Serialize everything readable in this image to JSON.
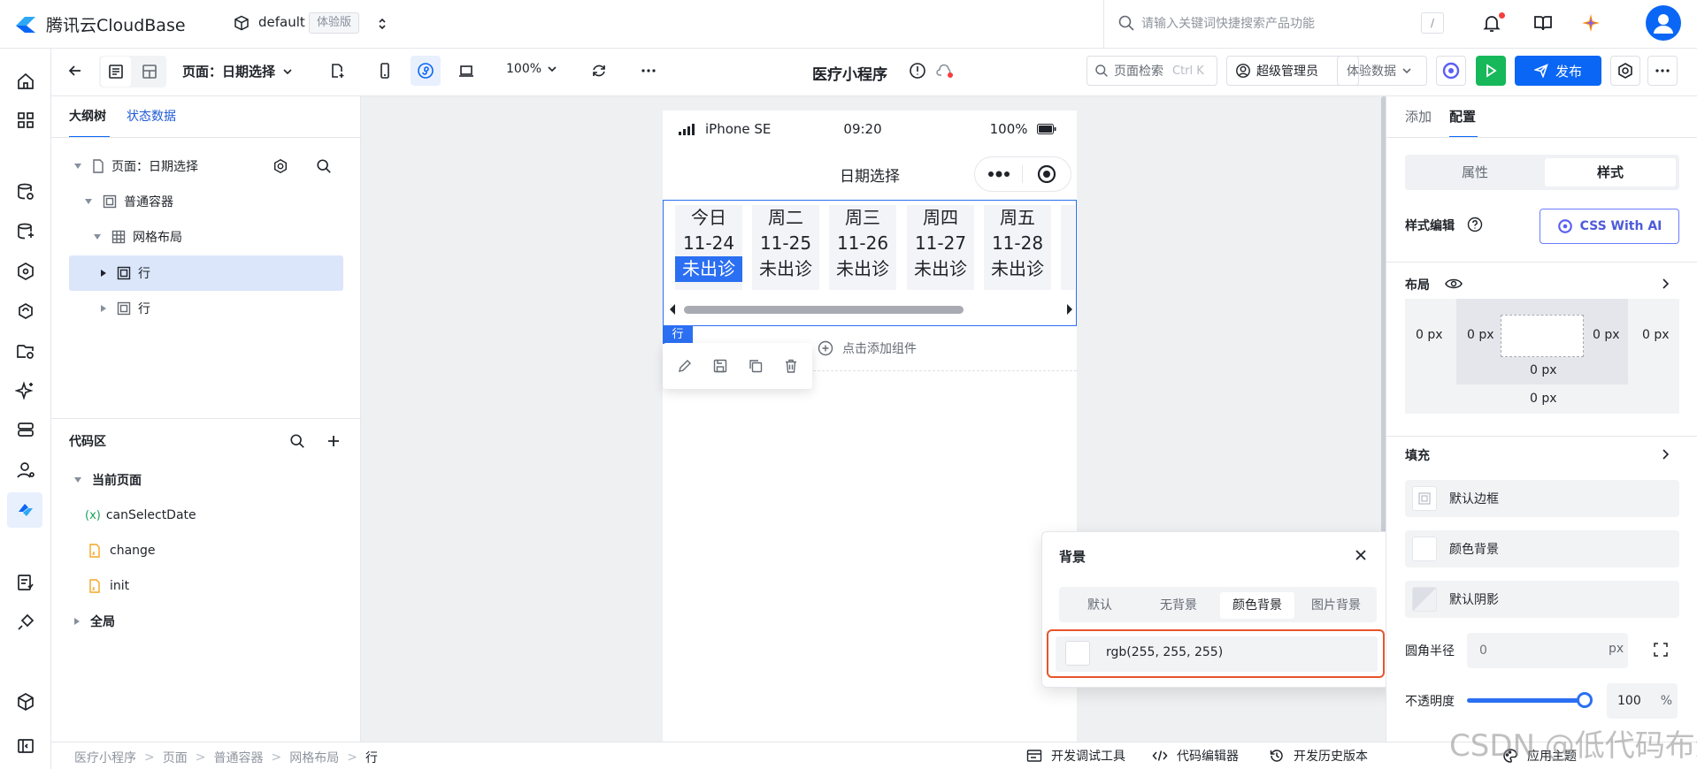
{
  "header": {
    "brand": "腾讯云CloudBase",
    "env_name": "default",
    "env_badge": "体验版",
    "search_placeholder": "请输入关键词快捷搜索产品功能",
    "search_shortcut": "/"
  },
  "toolbar": {
    "page_selector": "页面：日期选择",
    "zoom": "100%",
    "app_title": "医疗小程序",
    "page_search_label": "页面检索",
    "page_search_shortcut": "Ctrl K",
    "role": "超级管理员",
    "data_mode": "体验数据",
    "publish": "发布"
  },
  "left_panel": {
    "tabs": [
      "大纲树",
      "状态数据"
    ],
    "tree": [
      {
        "label": "页面：日期选择",
        "level": 0
      },
      {
        "label": "普通容器",
        "level": 1
      },
      {
        "label": "网格布局",
        "level": 2
      },
      {
        "label": "行",
        "level": 3,
        "selected": true
      },
      {
        "label": "行",
        "level": 3
      }
    ],
    "code_title": "代码区",
    "code_groups": {
      "current_page": "当前页面",
      "items": [
        {
          "name": "canSelectDate",
          "kind": "variable",
          "icon": "(x)"
        },
        {
          "name": "change",
          "kind": "js"
        },
        {
          "name": "init",
          "kind": "js"
        }
      ],
      "global": "全局"
    }
  },
  "phone": {
    "device": "iPhone SE",
    "time": "09:20",
    "battery": "100%",
    "nav_title": "日期选择",
    "days": [
      {
        "day": "今日",
        "date": "11-24",
        "status": "未出诊",
        "today": true
      },
      {
        "day": "周二",
        "date": "11-25",
        "status": "未出诊"
      },
      {
        "day": "周三",
        "date": "11-26",
        "status": "未出诊"
      },
      {
        "day": "周四",
        "date": "11-27",
        "status": "未出诊"
      },
      {
        "day": "周五",
        "date": "11-28",
        "status": "未出诊"
      },
      {
        "day": "周",
        "date": "1",
        "status": "未"
      }
    ],
    "row_tag": "行",
    "add_component": "点击添加组件"
  },
  "bg_popover": {
    "title": "背景",
    "tabs": [
      "默认",
      "无背景",
      "颜色背景",
      "图片背景"
    ],
    "active_tab": 2,
    "color_value": "rgb(255, 255, 255)"
  },
  "right_panel": {
    "tabs": [
      "添加",
      "配置"
    ],
    "seg_props": "属性",
    "seg_style": "样式",
    "style_edit": "样式编辑",
    "css_ai": "CSS With AI",
    "layout": "布局",
    "px_value": "0 px",
    "fill": "填充",
    "fill_rows": [
      "默认边框",
      "颜色背景",
      "默认阴影"
    ],
    "radius_label": "圆角半径",
    "radius_value": "0",
    "radius_unit": "px",
    "opacity_label": "不透明度",
    "opacity_value": "100",
    "opacity_unit": "%"
  },
  "bottom": {
    "breadcrumb": [
      "医疗小程序",
      "页面",
      "普通容器",
      "网格布局",
      "行"
    ],
    "debug_tool": "开发调试工具",
    "code_editor": "代码编辑器",
    "history": "开发历史版本",
    "theme": "应用主题",
    "watermark": "CSDN @低代码布道师"
  },
  "colors": {
    "primary": "#0a66f5",
    "run": "#16b85a",
    "highlight_border": "#e8542c"
  }
}
